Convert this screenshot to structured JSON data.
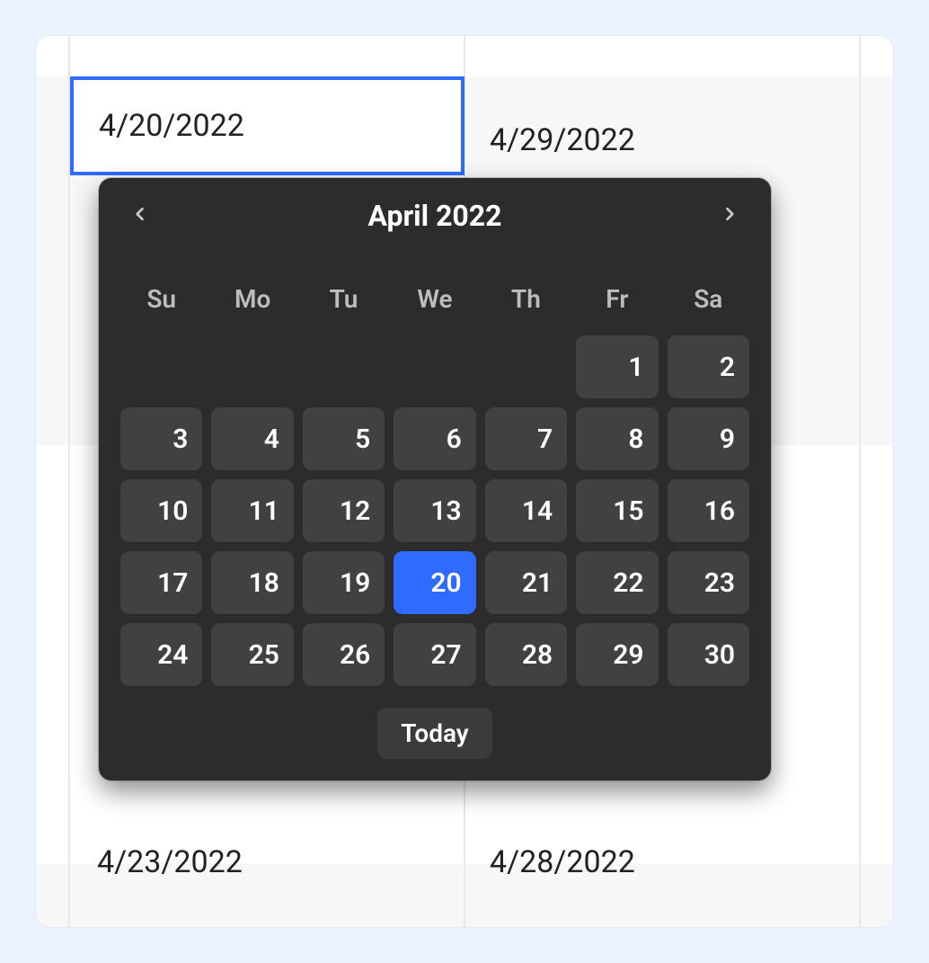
{
  "cells": {
    "active_value": "4/20/2022",
    "right_value": "4/29/2022",
    "bottom_left": "4/23/2022",
    "bottom_right": "4/28/2022"
  },
  "datepicker": {
    "month_label": "April 2022",
    "today_label": "Today",
    "selected_day": 20,
    "dow": [
      "Su",
      "Mo",
      "Tu",
      "We",
      "Th",
      "Fr",
      "Sa"
    ],
    "weeks": [
      [
        null,
        null,
        null,
        null,
        null,
        1,
        2
      ],
      [
        3,
        4,
        5,
        6,
        7,
        8,
        9
      ],
      [
        10,
        11,
        12,
        13,
        14,
        15,
        16
      ],
      [
        17,
        18,
        19,
        20,
        21,
        22,
        23
      ],
      [
        24,
        25,
        26,
        27,
        28,
        29,
        30
      ]
    ]
  }
}
